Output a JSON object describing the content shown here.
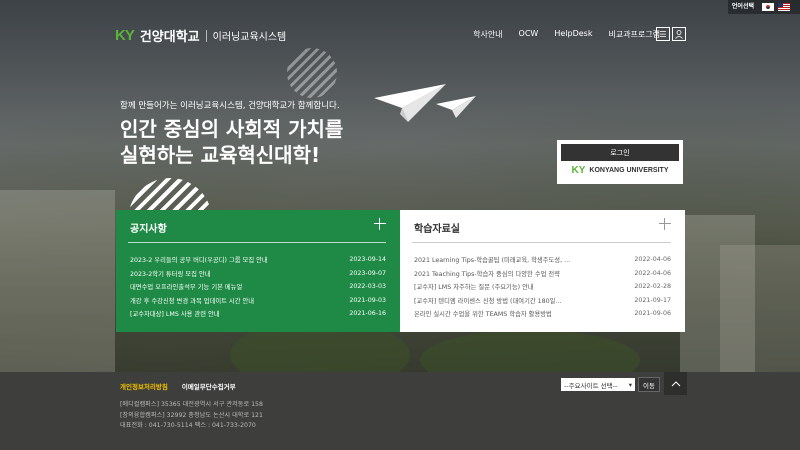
{
  "topbar": {
    "lang_label": "언어선택"
  },
  "logo": {
    "mark": "KY",
    "name": "건양대학교",
    "subtitle": "이러닝교육시스템"
  },
  "nav": {
    "items": [
      "학사안내",
      "OCW",
      "HelpDesk",
      "비교과프로그램"
    ]
  },
  "hero": {
    "subtitle": "함께 만들어가는 이러닝교육시스템, 건양대학교가 함께합니다.",
    "title_line1": "인간 중심의 사회적 가치를",
    "title_line2": "실현하는 교육혁신대학!"
  },
  "login": {
    "button": "로그인",
    "brand_mark": "KY",
    "brand_name": "KONYANG UNIVERSITY"
  },
  "notice": {
    "title": "공지사항",
    "items": [
      {
        "title": "2023-2 우리들의 공부 버디(우공디) 그룹 모집 안내",
        "date": "2023-09-14"
      },
      {
        "title": "2023-2학기 튜터링 모집 안내",
        "date": "2023-09-07"
      },
      {
        "title": "대면수업 오프라인출석부 기능 기본 메뉴얼",
        "date": "2022-03-03"
      },
      {
        "title": "개강 후 수강신청 변경 과목 업데이트 시간 안내",
        "date": "2021-09-03"
      },
      {
        "title": "[교수자대상] LMS 사용 관련 안내",
        "date": "2021-06-16"
      }
    ]
  },
  "study": {
    "title": "학습자료실",
    "items": [
      {
        "title": "2021 Learning Tips-학습꿀팁 (미래교육, 학생주도성, ...",
        "date": "2022-04-06"
      },
      {
        "title": "2021 Teaching Tips-학습자 중심의 다양한 수업 전략",
        "date": "2022-04-06"
      },
      {
        "title": "[교수자] LMS 자주하는 질문 (주요기능) 안내",
        "date": "2022-02-28"
      },
      {
        "title": "[교수자] 텐디엠 라이센스 신청 방법 (대여기간 180일...",
        "date": "2021-09-17"
      },
      {
        "title": "온라인 실시간 수업을 위한 TEAMS 학습자 활용방법",
        "date": "2021-09-06"
      }
    ]
  },
  "footer": {
    "privacy": "개인정보처리방침",
    "email_policy": "이메일무단수집거부",
    "addr1": "[메디컬캠퍼스] 35365 대전광역시 서구 관저동로 158",
    "addr2": "[창의융합캠퍼스] 32992 충청남도 논산시 대학로 121",
    "phone": "대표전화 : 041-730-5114 팩스 : 041-733-2070",
    "family_select": "--주요사이트 선택--",
    "go_button": "이동"
  },
  "colors": {
    "green": "#1e8a45",
    "brand_green": "#5ab33a",
    "footer_bg": "#3e3e3c",
    "highlight": "#f0c000"
  }
}
